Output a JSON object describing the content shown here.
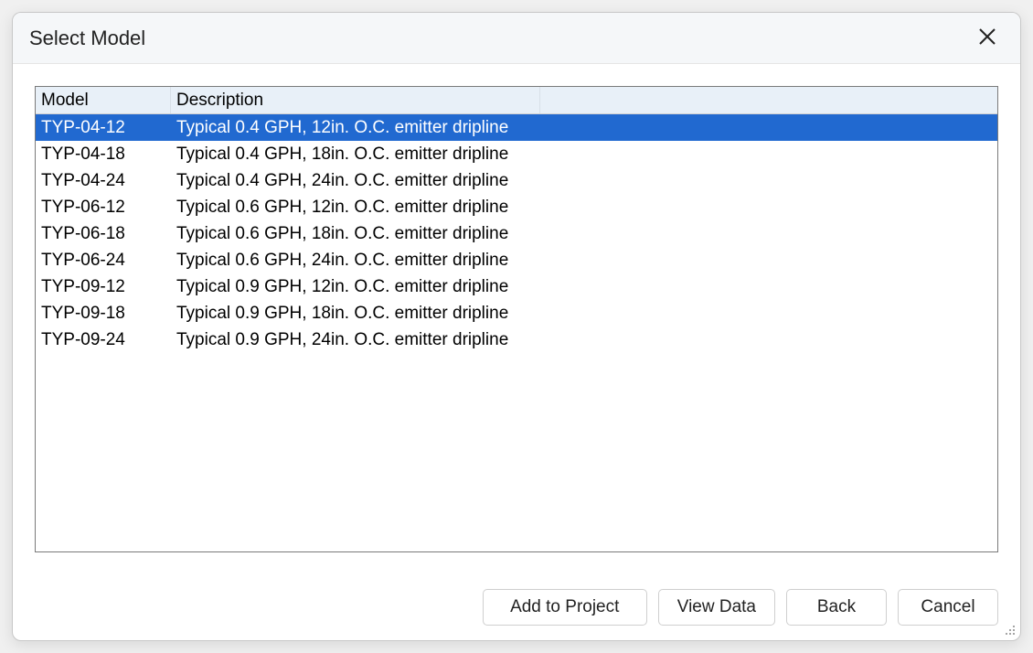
{
  "dialog": {
    "title": "Select Model"
  },
  "table": {
    "headers": {
      "model": "Model",
      "description": "Description"
    },
    "rows": [
      {
        "model": "TYP-04-12",
        "description": "Typical 0.4 GPH, 12in. O.C. emitter dripline",
        "selected": true
      },
      {
        "model": "TYP-04-18",
        "description": "Typical 0.4 GPH, 18in. O.C. emitter dripline",
        "selected": false
      },
      {
        "model": "TYP-04-24",
        "description": "Typical 0.4 GPH, 24in. O.C.  emitter dripline",
        "selected": false
      },
      {
        "model": "TYP-06-12",
        "description": "Typical 0.6 GPH, 12in. O.C. emitter dripline",
        "selected": false
      },
      {
        "model": "TYP-06-18",
        "description": "Typical 0.6 GPH, 18in. O.C. emitter dripline",
        "selected": false
      },
      {
        "model": "TYP-06-24",
        "description": "Typical 0.6 GPH, 24in. O.C. emitter dripline",
        "selected": false
      },
      {
        "model": "TYP-09-12",
        "description": "Typical 0.9 GPH, 12in. O.C. emitter dripline",
        "selected": false
      },
      {
        "model": "TYP-09-18",
        "description": "Typical 0.9 GPH, 18in. O.C. emitter dripline",
        "selected": false
      },
      {
        "model": "TYP-09-24",
        "description": "Typical 0.9 GPH, 24in. O.C. emitter dripline",
        "selected": false
      }
    ]
  },
  "buttons": {
    "add": "Add to Project",
    "view": "View Data",
    "back": "Back",
    "cancel": "Cancel"
  }
}
